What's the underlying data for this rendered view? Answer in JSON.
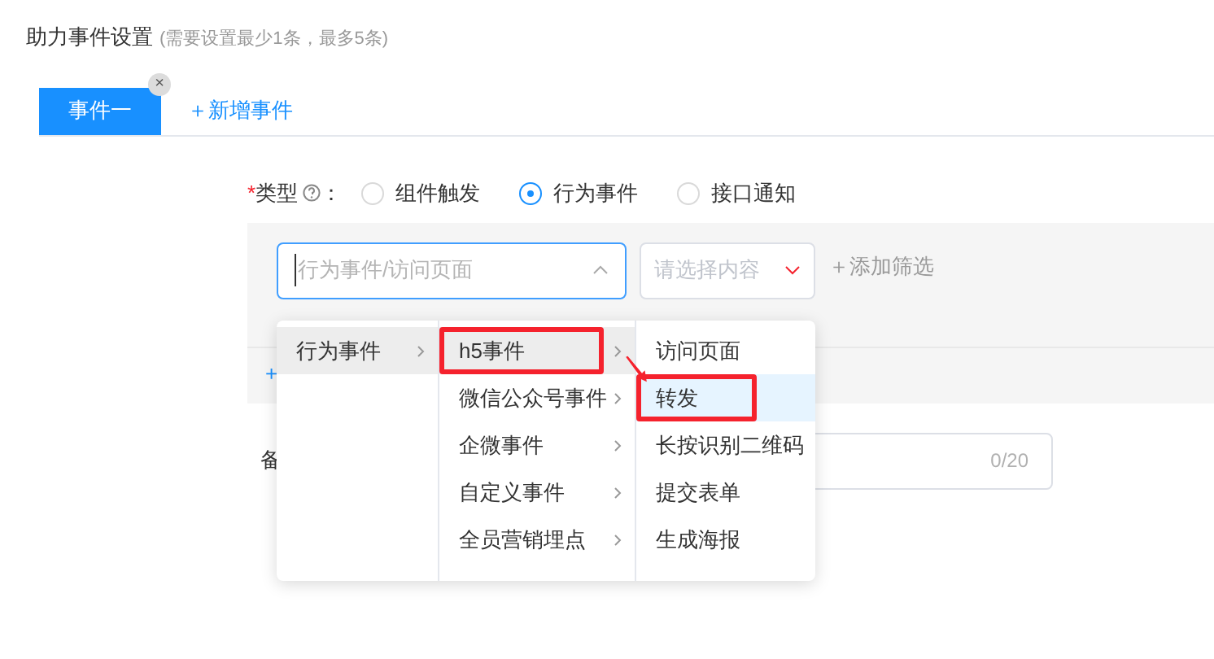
{
  "section": {
    "title": "助力事件设置",
    "hint": "(需要设置最少1条，最多5条)"
  },
  "tabs": [
    {
      "label": "事件一",
      "selected": true,
      "closable": true,
      "close": "×"
    }
  ],
  "add_tab": "＋新增事件",
  "type_field": {
    "required_mark": "*",
    "label": "类型",
    "suffix": "：",
    "options": [
      {
        "label": "组件触发",
        "selected": false
      },
      {
        "label": "行为事件",
        "selected": true
      },
      {
        "label": "接口通知",
        "selected": false
      }
    ]
  },
  "filter": {
    "cascader": {
      "placeholder": "行为事件/访问页面",
      "expanded": true
    },
    "select": {
      "placeholder": "请选择内容"
    },
    "add_filter": "＋添加筛选",
    "add_row": "+"
  },
  "remark": {
    "label": "备",
    "counter": "0/20"
  },
  "cascader_menu": [
    {
      "items": [
        {
          "label": "行为事件",
          "selected": true,
          "has_children": true,
          "annotated": false
        }
      ]
    },
    {
      "items": [
        {
          "label": "h5事件",
          "selected": true,
          "has_children": true,
          "annotated": true
        },
        {
          "label": "微信公众号事件",
          "selected": false,
          "has_children": true,
          "annotated": false
        },
        {
          "label": "企微事件",
          "selected": false,
          "has_children": true,
          "annotated": false
        },
        {
          "label": "自定义事件",
          "selected": false,
          "has_children": true,
          "annotated": false
        },
        {
          "label": "全员营销埋点",
          "selected": false,
          "has_children": true,
          "annotated": false
        }
      ]
    },
    {
      "items": [
        {
          "label": "访问页面",
          "selected": false,
          "has_children": false,
          "annotated": false
        },
        {
          "label": "转发",
          "selected": true,
          "has_children": false,
          "annotated": true
        },
        {
          "label": "长按识别二维码",
          "selected": false,
          "has_children": false,
          "annotated": false
        },
        {
          "label": "提交表单",
          "selected": false,
          "has_children": false,
          "annotated": false
        },
        {
          "label": "生成海报",
          "selected": false,
          "has_children": false,
          "annotated": false
        }
      ]
    }
  ]
}
